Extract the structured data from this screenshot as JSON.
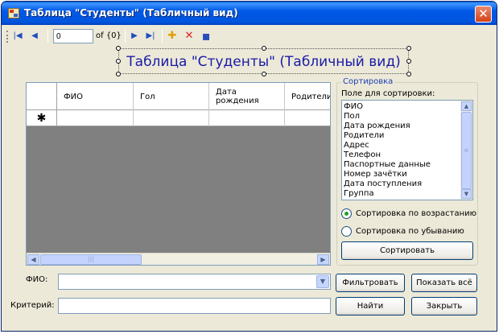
{
  "window": {
    "title": "Таблица \"Студенты\" (Табличный вид)",
    "close_glyph": "✕"
  },
  "toolbar": {
    "first_icon": "|◀",
    "prev_icon": "◀",
    "position_value": "0",
    "of_label": "of {0}",
    "next_icon": "▶",
    "last_icon": "▶|",
    "add_icon": "✚",
    "delete_icon": "✕",
    "save_icon": "▪"
  },
  "heading": "Таблица \"Студенты\" (Табличный вид)",
  "grid": {
    "columns": [
      "ФИО",
      "Гол",
      "Дата\nрождения",
      "Родители"
    ],
    "new_row_marker": "✱",
    "scroll_left": "◀",
    "scroll_right": "▶",
    "scroll_grip": "|||"
  },
  "sort": {
    "group_label": "Сортировка",
    "field_label": "Поле для сортировки:",
    "fields": [
      "ФИО",
      "Пол",
      "Дата рождения",
      "Родители",
      "Адрес",
      "Телефон",
      "Паспортные данные",
      "Номер зачётки",
      "Дата поступления",
      "Группа"
    ],
    "asc_label": "Сортировка по возрастанию",
    "desc_label": "Сортировка по убыванию",
    "selected_order": "asc",
    "button_label": "Сортировать",
    "scroll_up": "▲",
    "scroll_down": "▼",
    "scroll_grip": "≡"
  },
  "filter": {
    "fio_label": "ФИО:",
    "fio_value": "",
    "combo_arrow": "▼",
    "criterion_label": "Критерий:",
    "criterion_value": "",
    "filter_button": "Фильтровать",
    "show_all_button": "Показать всё",
    "find_button": "Найти",
    "close_button": "Закрыть"
  },
  "colors": {
    "accent": "#1a1aa6",
    "group_title": "#1a3fb5",
    "grid_bg": "#808080"
  }
}
